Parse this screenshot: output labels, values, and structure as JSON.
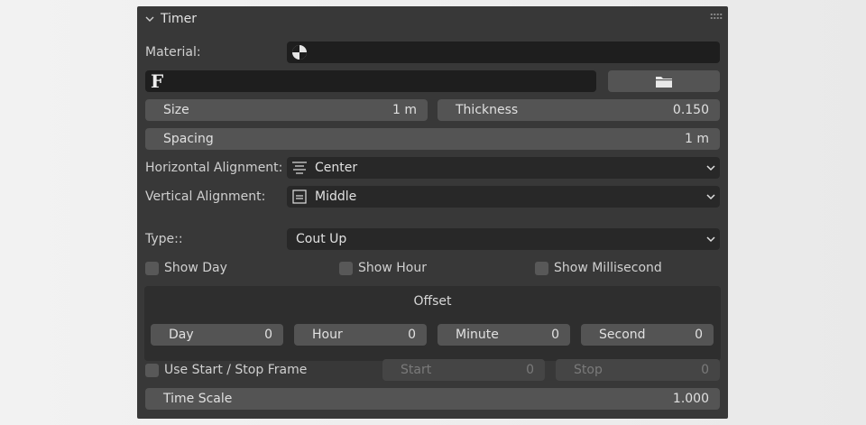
{
  "panel": {
    "title": "Timer"
  },
  "material": {
    "label": "Material:",
    "value": ""
  },
  "font": {
    "glyph": "F",
    "value": ""
  },
  "size": {
    "label": "Size",
    "value": "1 m"
  },
  "thickness": {
    "label": "Thickness",
    "value": "0.150"
  },
  "spacing": {
    "label": "Spacing",
    "value": "1 m"
  },
  "horizontal_alignment": {
    "label": "Horizontal Alignment:",
    "value": "Center"
  },
  "vertical_alignment": {
    "label": "Vertical Alignment:",
    "value": "Middle"
  },
  "type": {
    "label": "Type::",
    "value": "Cout Up"
  },
  "checkboxes": {
    "show_day": "Show Day",
    "show_hour": "Show Hour",
    "show_millisecond": "Show Millisecond"
  },
  "offset": {
    "title": "Offset",
    "day": {
      "label": "Day",
      "value": "0"
    },
    "hour": {
      "label": "Hour",
      "value": "0"
    },
    "minute": {
      "label": "Minute",
      "value": "0"
    },
    "second": {
      "label": "Second",
      "value": "0"
    }
  },
  "start_stop": {
    "label": "Use Start / Stop Frame",
    "start": {
      "label": "Start",
      "value": "0"
    },
    "stop": {
      "label": "Stop",
      "value": "0"
    }
  },
  "time_scale": {
    "label": "Time Scale",
    "value": "1.000"
  }
}
